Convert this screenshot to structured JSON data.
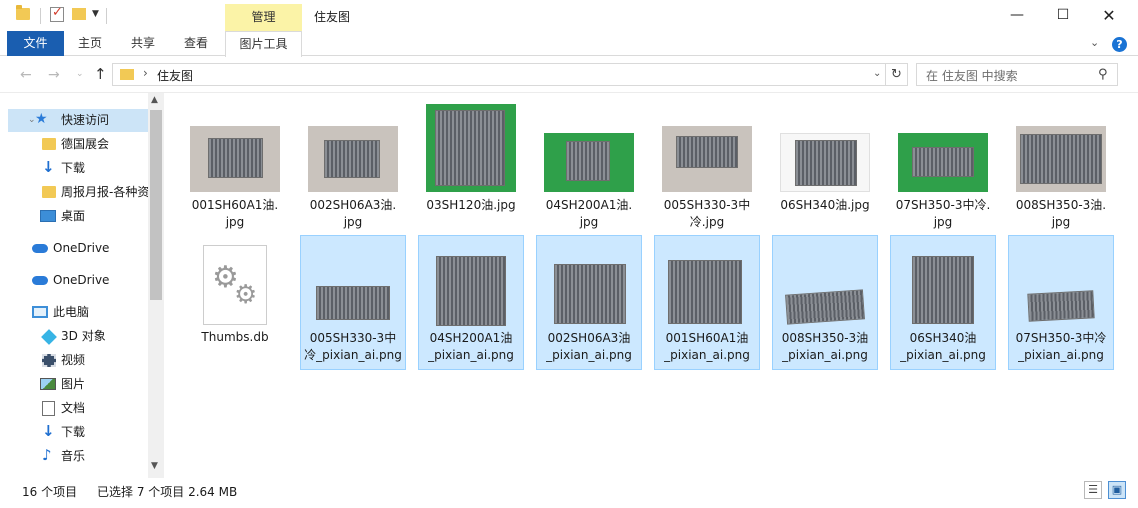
{
  "window": {
    "title": "住友图",
    "context_tab_header": "管理",
    "minimize": "—",
    "maximize": "☐",
    "close": "✕"
  },
  "ribbon": {
    "tabs": [
      "文件",
      "主页",
      "共享",
      "查看",
      "图片工具"
    ],
    "active_color": "#1a5eb0",
    "help": "?"
  },
  "address": {
    "path": "住友图",
    "separator": "›",
    "search_placeholder": "在 住友图 中搜索"
  },
  "nav_pane": {
    "items": [
      {
        "label": "快速访问",
        "icon": "star-icon"
      },
      {
        "label": "德国展会",
        "icon": "folder-icon"
      },
      {
        "label": "下载",
        "icon": "download-icon"
      },
      {
        "label": "周报月报-各种资",
        "icon": "folder-icon"
      },
      {
        "label": "桌面",
        "icon": "desktop-icon"
      },
      {
        "label": "OneDrive",
        "icon": "cloud-icon"
      },
      {
        "label": "OneDrive",
        "icon": "cloud-icon"
      },
      {
        "label": "此电脑",
        "icon": "pc-icon"
      },
      {
        "label": "3D 对象",
        "icon": "cube-icon"
      },
      {
        "label": "视频",
        "icon": "video-icon"
      },
      {
        "label": "图片",
        "icon": "picture-icon"
      },
      {
        "label": "文档",
        "icon": "document-icon"
      },
      {
        "label": "下载",
        "icon": "download-icon"
      },
      {
        "label": "音乐",
        "icon": "music-icon"
      }
    ]
  },
  "files": [
    {
      "name": "001SH60A1油.jpg",
      "selected": false
    },
    {
      "name": "002SH06A3油.jpg",
      "selected": false
    },
    {
      "name": "03SH120油.jpg",
      "selected": false
    },
    {
      "name": "04SH200A1油.jpg",
      "selected": false
    },
    {
      "name": "005SH330-3中冷.jpg",
      "selected": false
    },
    {
      "name": "06SH340油.jpg",
      "selected": false
    },
    {
      "name": "07SH350-3中冷.jpg",
      "selected": false
    },
    {
      "name": "008SH350-3油.jpg",
      "selected": false
    },
    {
      "name": "Thumbs.db",
      "selected": false
    },
    {
      "name": "005SH330-3中冷_pixian_ai.png",
      "selected": true
    },
    {
      "name": "04SH200A1油_pixian_ai.png",
      "selected": true
    },
    {
      "name": "002SH06A3油_pixian_ai.png",
      "selected": true
    },
    {
      "name": "001SH60A1油_pixian_ai.png",
      "selected": true
    },
    {
      "name": "008SH350-3油_pixian_ai.png",
      "selected": true
    },
    {
      "name": "06SH340油_pixian_ai.png",
      "selected": true
    },
    {
      "name": "07SH350-3中冷_pixian_ai.png",
      "selected": true
    }
  ],
  "labels_display": [
    "001SH60A1油.\njpg",
    "002SH06A3油.\njpg",
    "03SH120油.jpg",
    "04SH200A1油.\njpg",
    "005SH330-3中\n冷.jpg",
    "06SH340油.jpg",
    "07SH350-3中冷.\njpg",
    "008SH350-3油.\njpg",
    "Thumbs.db",
    "005SH330-3中\n冷_pixian_ai.png",
    "04SH200A1油\n_pixian_ai.png",
    "002SH06A3油\n_pixian_ai.png",
    "001SH60A1油\n_pixian_ai.png",
    "008SH350-3油\n_pixian_ai.png",
    "06SH340油\n_pixian_ai.png",
    "07SH350-3中冷\n_pixian_ai.png"
  ],
  "status": {
    "item_count": "16 个项目",
    "selection": "已选择 7 个项目  2.64 MB"
  },
  "colors": {
    "selection_bg": "#cce8ff",
    "selection_border": "#99d1ff",
    "nav_selected": "#cce4f7"
  }
}
